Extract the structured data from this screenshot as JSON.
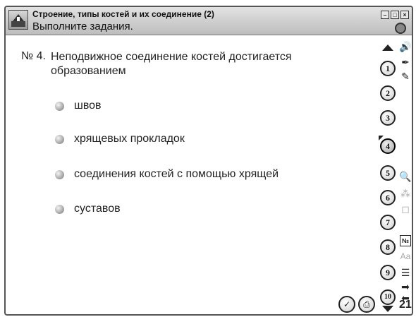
{
  "titlebar": {
    "title": "Строение, типы костей и их соединение (2)",
    "subtitle": "Выполните задания.",
    "minimize": "–",
    "maximize": "□",
    "close": "×"
  },
  "question": {
    "number": "№ 4.",
    "text": "Неподвижное соединение костей достигается образованием"
  },
  "answers": [
    "швов",
    "хрящевых прокладок",
    "соединения костей с помощью хрящей",
    "суставов"
  ],
  "nav": {
    "items": [
      "1",
      "2",
      "3",
      "4",
      "5",
      "6",
      "7",
      "8",
      "9",
      "10"
    ],
    "active": "4"
  },
  "tools": {
    "sound": "🔊",
    "pen": "✒",
    "pencil": "✎",
    "zoom": "🔍",
    "puzzle": "⁂",
    "cube": "◻",
    "num": "№",
    "font": "Aa",
    "list": "☰",
    "next": "➡",
    "back": "⬅",
    "page_number": "21"
  },
  "bottom": {
    "check_icon": "✓",
    "print_icon": "⎙"
  }
}
